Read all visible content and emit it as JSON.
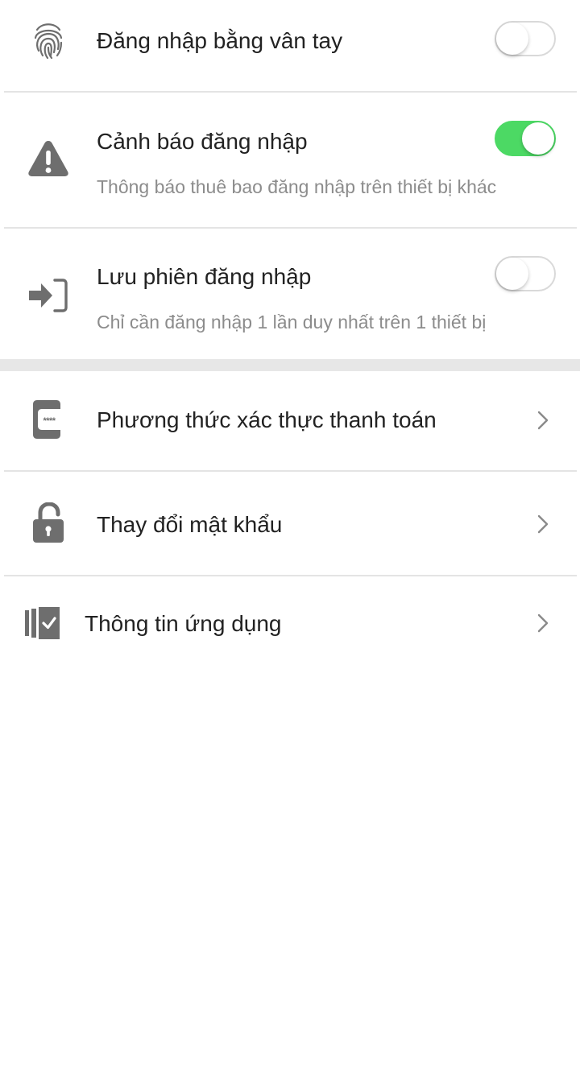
{
  "settings": {
    "fingerprint_login": {
      "icon": "fingerprint-icon",
      "title": "Đăng nhập bằng vân tay",
      "enabled": false
    },
    "login_alert": {
      "icon": "warning-icon",
      "title": "Cảnh báo đăng nhập",
      "subtitle": "Thông báo thuê bao đăng nhập trên thiết bị khác",
      "enabled": true
    },
    "save_session": {
      "icon": "sign-in-icon",
      "title": "Lưu phiên đăng nhập",
      "subtitle": "Chỉ cần đăng nhập 1 lần duy nhất trên 1 thiết bị",
      "enabled": false
    }
  },
  "menu": {
    "payment_auth": {
      "icon": "password-chat-icon",
      "title": "Phương thức xác thực thanh toán"
    },
    "change_password": {
      "icon": "unlock-icon",
      "title": "Thay đổi mật khẩu"
    },
    "app_info": {
      "icon": "app-info-icon",
      "title": "Thông tin ứng dụng"
    }
  },
  "colors": {
    "toggle_on": "#4cd964",
    "toggle_off_border": "#d9d9d9",
    "icon_gray": "#6e6e6e",
    "title_text": "#222222",
    "subtitle_text": "#8c8c8c",
    "divider": "#e4e4e4"
  }
}
